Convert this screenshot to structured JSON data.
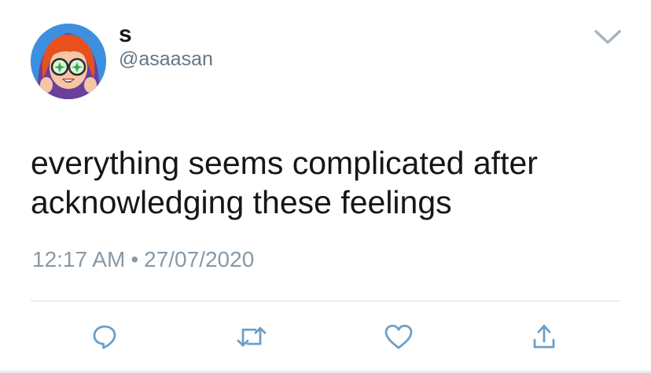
{
  "tweet": {
    "display_name": "s",
    "handle": "@asaasan",
    "text": "everything seems complicated after acknowledging these feelings",
    "time": "12:17 AM",
    "separator": "•",
    "date": "27/07/2020"
  },
  "actions": [
    {
      "icon": "reply-icon"
    },
    {
      "icon": "retweet-icon"
    },
    {
      "icon": "like-icon"
    },
    {
      "icon": "share-icon"
    }
  ],
  "colors": {
    "text": "#14171a",
    "secondary": "#657786",
    "icon": "#6c9fc7",
    "divider": "#d8dee3",
    "avatar_bg": "#3d8fe0",
    "hair": "#e8501e"
  }
}
